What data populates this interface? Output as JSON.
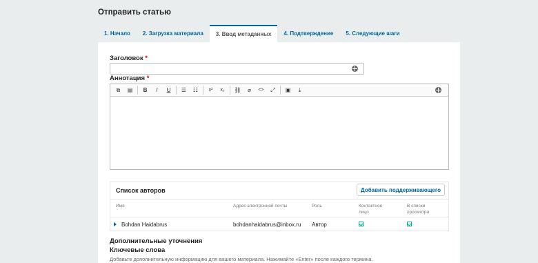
{
  "page": {
    "title": "Отправить статью"
  },
  "tabs": [
    {
      "label": "1. Начало"
    },
    {
      "label": "2. Загрузка материала"
    },
    {
      "label": "3. Ввод метаданных",
      "active": true
    },
    {
      "label": "4. Подтверждение"
    },
    {
      "label": "5. Следующие шаги"
    }
  ],
  "form": {
    "title_label": "Заголовок",
    "abstract_label": "Аннотация",
    "required_mark": "*",
    "title_value": "",
    "language_icon": "globe-icon"
  },
  "toolbar": {
    "buttons": [
      {
        "name": "copy-icon",
        "glyph": "⧉"
      },
      {
        "name": "paste-icon",
        "glyph": "▤"
      },
      {
        "name": "bold-icon",
        "glyph": "B"
      },
      {
        "name": "italic-icon",
        "glyph": "I"
      },
      {
        "name": "underline-icon",
        "glyph": "U"
      },
      {
        "name": "bullet-list-icon",
        "glyph": "☰"
      },
      {
        "name": "numbered-list-icon",
        "glyph": "☷"
      },
      {
        "name": "superscript-icon",
        "glyph": "x²"
      },
      {
        "name": "subscript-icon",
        "glyph": "x₂"
      },
      {
        "name": "link-icon",
        "glyph": "⛓"
      },
      {
        "name": "unlink-icon",
        "glyph": "⌀"
      },
      {
        "name": "code-icon",
        "glyph": "<>"
      },
      {
        "name": "fullscreen-icon",
        "glyph": "⤢"
      },
      {
        "name": "image-icon",
        "glyph": "▣"
      },
      {
        "name": "upload-icon",
        "glyph": "⤓"
      }
    ]
  },
  "authors": {
    "title": "Список авторов",
    "add_button": "Добавить поддерживающего",
    "columns": {
      "name": "Имя",
      "email": "Адрес электронной почты",
      "role": "Роль",
      "contact": "Контактное лицо",
      "browse": "В списки просмотра"
    },
    "rows": [
      {
        "name": "Bohdan Haidabrus",
        "email": "bohdanhaidabrus@inbox.ru",
        "role": "Автор",
        "contact": true,
        "browse": true
      }
    ]
  },
  "additional": {
    "title": "Дополнительные уточнения",
    "keywords_label": "Ключевые слова",
    "keywords_desc": "Добавьте дополнительную информацию для вашего материала. Нажимайте «Enter» после каждого термина."
  },
  "colors": {
    "accent": "#006798",
    "required": "#d00a0a",
    "check": "#00b28d"
  }
}
